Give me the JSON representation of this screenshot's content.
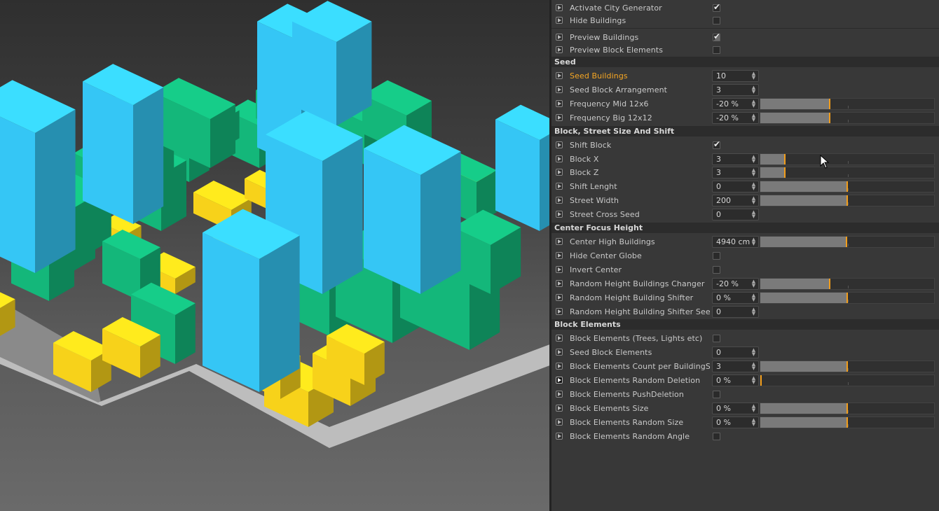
{
  "panel": {
    "rows": [
      {
        "type": "check",
        "label": "Activate City Generator",
        "checked": true
      },
      {
        "type": "check",
        "label": "Hide Buildings",
        "checked": false
      },
      {
        "type": "sep"
      },
      {
        "type": "check",
        "label": "Preview Buildings",
        "checked": true,
        "partial": true
      },
      {
        "type": "check",
        "label": "Preview Block Elements",
        "checked": false
      },
      {
        "type": "section",
        "label": "Seed"
      },
      {
        "type": "num",
        "label": "Seed Buildings",
        "value": "10",
        "highlight": true
      },
      {
        "type": "num",
        "label": "Seed Block Arrangement",
        "value": "3"
      },
      {
        "type": "slider",
        "label": "Frequency Mid 12x6",
        "value": "-20 %",
        "fill": 0.4
      },
      {
        "type": "slider",
        "label": "Frequency Big 12x12",
        "value": "-20 %",
        "fill": 0.4
      },
      {
        "type": "section",
        "label": "Block, Street Size And Shift"
      },
      {
        "type": "check",
        "label": "Shift Block",
        "checked": true
      },
      {
        "type": "slider",
        "label": "Block X",
        "value": "3",
        "fill": 0.14
      },
      {
        "type": "slider",
        "label": "Block Z",
        "value": "3",
        "fill": 0.14
      },
      {
        "type": "slider",
        "label": "Shift Lenght",
        "value": "0",
        "fill": 0.5
      },
      {
        "type": "slider",
        "label": "Street Width",
        "value": "200",
        "fill": 0.5
      },
      {
        "type": "num",
        "label": "Street Cross Seed",
        "value": "0"
      },
      {
        "type": "section",
        "label": "Center Focus Height"
      },
      {
        "type": "slider",
        "label": "Center High Buildings",
        "value": "4940 cm",
        "fill": 0.495
      },
      {
        "type": "check",
        "label": "Hide Center Globe",
        "checked": false
      },
      {
        "type": "check",
        "label": "Invert Center",
        "checked": false
      },
      {
        "type": "slider",
        "label": "Random Height Buildings Changer",
        "value": "-20 %",
        "fill": 0.4
      },
      {
        "type": "slider",
        "label": "Random Height Building Shifter",
        "value": "0 %",
        "fill": 0.5
      },
      {
        "type": "num",
        "label": "Random Height Building Shifter Seed",
        "value": "0"
      },
      {
        "type": "section",
        "label": "Block Elements"
      },
      {
        "type": "check",
        "label": "Block Elements (Trees, Lights etc)",
        "checked": false
      },
      {
        "type": "num",
        "label": "Seed Block Elements",
        "value": "0"
      },
      {
        "type": "slider",
        "label": "Block Elements Count per BuildingSide",
        "value": "3",
        "fill": 0.5
      },
      {
        "type": "slider",
        "label": "Block Elements Random Deletion",
        "value": "0 %",
        "fill": 0.0,
        "key": true
      },
      {
        "type": "check",
        "label": "Block Elements PushDeletion",
        "checked": false
      },
      {
        "type": "slider",
        "label": "Block Elements Size",
        "value": "0 %",
        "fill": 0.5
      },
      {
        "type": "slider",
        "label": "Block Elements Random Size",
        "value": "0 %",
        "fill": 0.5
      },
      {
        "type": "check",
        "label": "Block Elements Random Angle",
        "checked": false
      }
    ]
  },
  "colors": {
    "accent": "#f29d1a",
    "building_blue": "#35c6f5",
    "building_green": "#14b77a",
    "building_yellow": "#f7d21a"
  },
  "icons": {
    "anim_toggle": "animation-keyframe-icon",
    "check_mark": "✔",
    "arrows": "▴▾",
    "cursor": "mouse-cursor-icon"
  }
}
